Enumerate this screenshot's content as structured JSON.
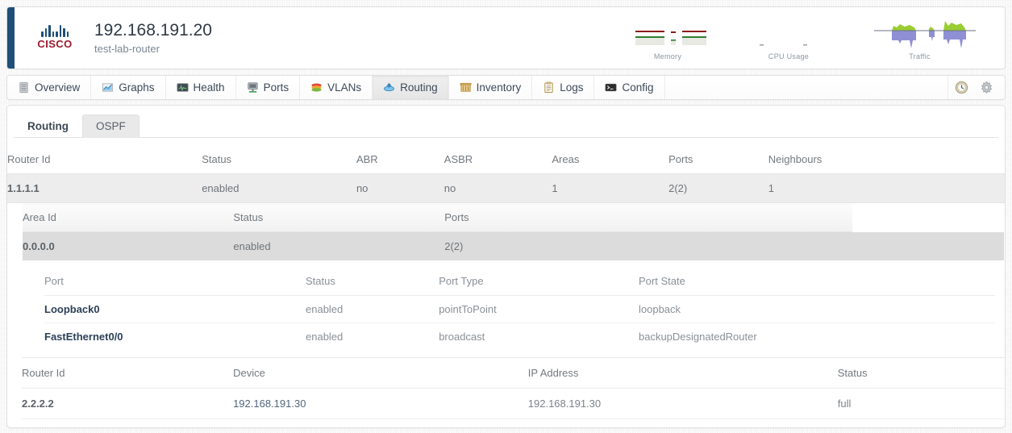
{
  "device": {
    "brand": "CISCO",
    "brand_icon": "cisco-logo-icon",
    "ip": "192.168.191.20",
    "hostname": "test-lab-router",
    "accent_color": "#1f4e79",
    "brand_color": "#9c1b2e"
  },
  "header_widgets": [
    {
      "label": "Memory",
      "icon": "memory-sparkline-icon"
    },
    {
      "label": "CPU Usage",
      "icon": "cpu-sparkline-icon"
    },
    {
      "label": "Traffic",
      "icon": "traffic-sparkline-icon"
    }
  ],
  "nav": {
    "tabs": [
      {
        "label": "Overview",
        "icon": "server-icon",
        "active": false
      },
      {
        "label": "Graphs",
        "icon": "chart-icon",
        "active": false
      },
      {
        "label": "Health",
        "icon": "monitor-icon",
        "active": false
      },
      {
        "label": "Ports",
        "icon": "ports-icon",
        "active": false
      },
      {
        "label": "VLANs",
        "icon": "vlans-icon",
        "active": false
      },
      {
        "label": "Routing",
        "icon": "routing-icon",
        "active": true
      },
      {
        "label": "Inventory",
        "icon": "inventory-icon",
        "active": false
      },
      {
        "label": "Logs",
        "icon": "logs-icon",
        "active": false
      },
      {
        "label": "Config",
        "icon": "terminal-icon",
        "active": false
      }
    ],
    "right_icons": [
      {
        "name": "history-clock-icon"
      },
      {
        "name": "gear-icon"
      }
    ]
  },
  "sub_tabs": [
    {
      "label": "Routing",
      "selected": false
    },
    {
      "label": "OSPF",
      "selected": true
    }
  ],
  "router_table": {
    "headers": [
      "Router Id",
      "Status",
      "ABR",
      "ASBR",
      "Areas",
      "Ports",
      "Neighbours"
    ],
    "row": {
      "router_id": "1.1.1.1",
      "status": "enabled",
      "abr": "no",
      "asbr": "no",
      "areas": "1",
      "ports": "2(2)",
      "neighbours": "1"
    }
  },
  "area_table": {
    "headers": [
      "Area Id",
      "Status",
      "Ports",
      ""
    ],
    "row": {
      "area_id": "0.0.0.0",
      "status": "enabled",
      "ports": "2(2)"
    }
  },
  "port_table": {
    "headers": [
      "Port",
      "Status",
      "Port Type",
      "Port State"
    ],
    "rows": [
      {
        "port": "Loopback0",
        "status": "enabled",
        "port_type": "pointToPoint",
        "port_state": "loopback"
      },
      {
        "port": "FastEthernet0/0",
        "status": "enabled",
        "port_type": "broadcast",
        "port_state": "backupDesignatedRouter"
      }
    ]
  },
  "neighbour_table": {
    "headers": [
      "Router Id",
      "Device",
      "IP Address",
      "Status"
    ],
    "rows": [
      {
        "router_id": "2.2.2.2",
        "device": "192.168.191.30",
        "ip_address": "192.168.191.30",
        "status": "full"
      }
    ]
  },
  "colors": {
    "ok_green": "#5aa84f",
    "link_navy": "#2c4159",
    "muted_gray": "#b6bbc0"
  }
}
